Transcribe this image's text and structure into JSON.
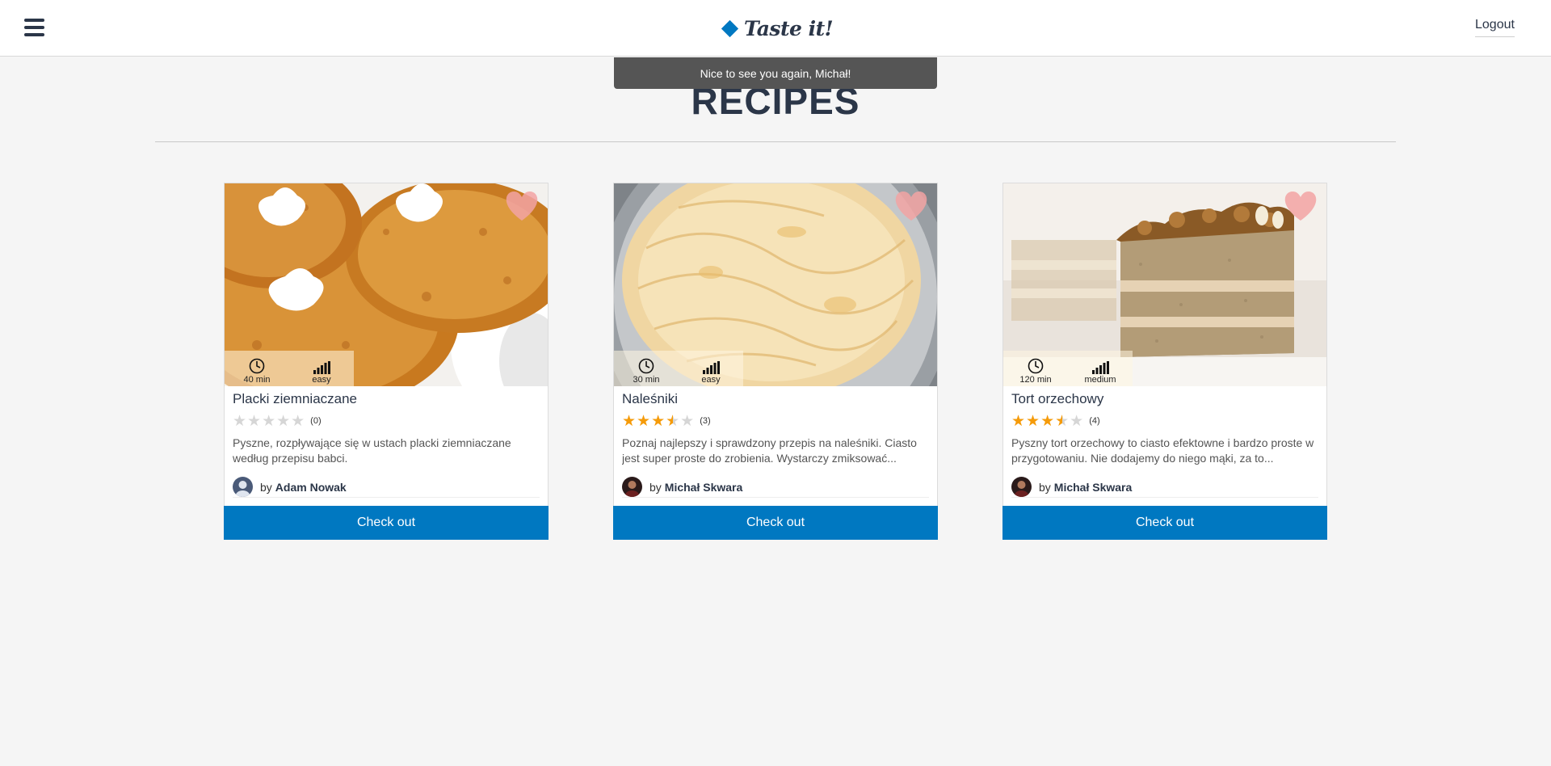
{
  "header": {
    "menu_icon": "hamburger-icon",
    "logo_text": "Taste it!",
    "logout_label": "Logout"
  },
  "notification": {
    "text": "Nice to see you again, Michał!"
  },
  "page": {
    "title": "RECIPES"
  },
  "colors": {
    "accent": "#0078c1",
    "star": "#f59b0a",
    "text": "#2b3648"
  },
  "recipes": [
    {
      "title": "Placki ziemniaczane",
      "time": "40 min",
      "difficulty": "easy",
      "rating": 0,
      "rating_count": "(0)",
      "description": "Pyszne, rozpływające się w ustach placki ziemniaczane według przepisu babci.",
      "by_label": "by",
      "author": "Adam Nowak",
      "button_label": "Check out"
    },
    {
      "title": "Naleśniki",
      "time": "30 min",
      "difficulty": "easy",
      "rating": 3.5,
      "rating_count": "(3)",
      "description": "Poznaj najlepszy i sprawdzony przepis na naleśniki. Ciasto jest super proste do zrobienia. Wystarczy zmiksować...",
      "by_label": "by",
      "author": "Michał Skwara",
      "button_label": "Check out"
    },
    {
      "title": "Tort orzechowy",
      "time": "120 min",
      "difficulty": "medium",
      "rating": 3.5,
      "rating_count": "(4)",
      "description": "Pyszny tort orzechowy to ciasto efektowne i bardzo proste w przygotowaniu. Nie dodajemy do niego mąki, za to...",
      "by_label": "by",
      "author": "Michał Skwara",
      "button_label": "Check out"
    }
  ]
}
